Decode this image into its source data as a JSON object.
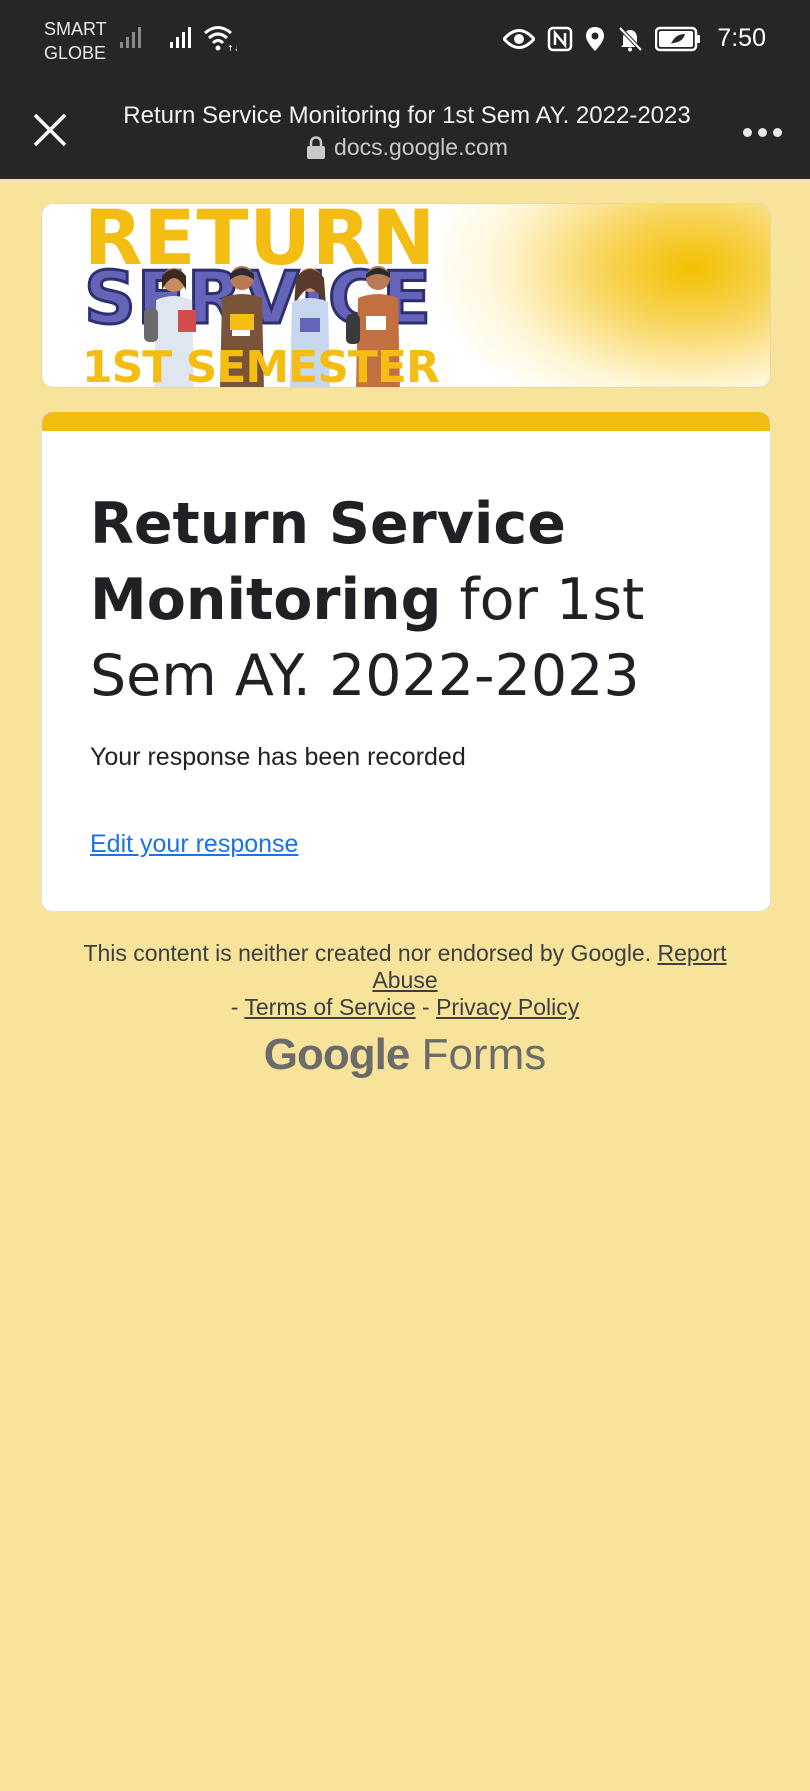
{
  "status_bar": {
    "carrier_line1": "SMART",
    "carrier_line2": "GLOBE",
    "time": "7:50",
    "icons": [
      "signal-icon",
      "signal-icon",
      "wifi-icon",
      "eye-icon",
      "nfc-icon",
      "location-icon",
      "bell-off-icon",
      "battery-icon"
    ]
  },
  "browser": {
    "page_title": "Return Service Monitoring for 1st Sem AY. 2022-2023",
    "url": "docs.google.com",
    "close_icon": "close-icon",
    "more_icon": "more-options-icon",
    "lock_icon": "lock-icon"
  },
  "banner": {
    "line1": "RETURN",
    "line2": "SERVICE",
    "line3": "1ST SEMESTER"
  },
  "form": {
    "title_bold": "Return Service Monitoring",
    "title_rest": " for 1st Sem AY. 2022-2023",
    "confirmation": "Your response has been recorded",
    "edit_link": "Edit your response",
    "accent_color": "#f4bd14"
  },
  "footer": {
    "disclaimer": "This content is neither created nor endorsed by Google.",
    "report": "Report Abuse",
    "sep1": " - ",
    "terms": "Terms of Service",
    "sep2": " - ",
    "privacy": "Privacy Policy",
    "brand_google": "Google",
    "brand_forms": "Forms"
  },
  "colors": {
    "page_background": "#f8e39b",
    "top_bar": "#252628",
    "link": "#1a73e8"
  }
}
